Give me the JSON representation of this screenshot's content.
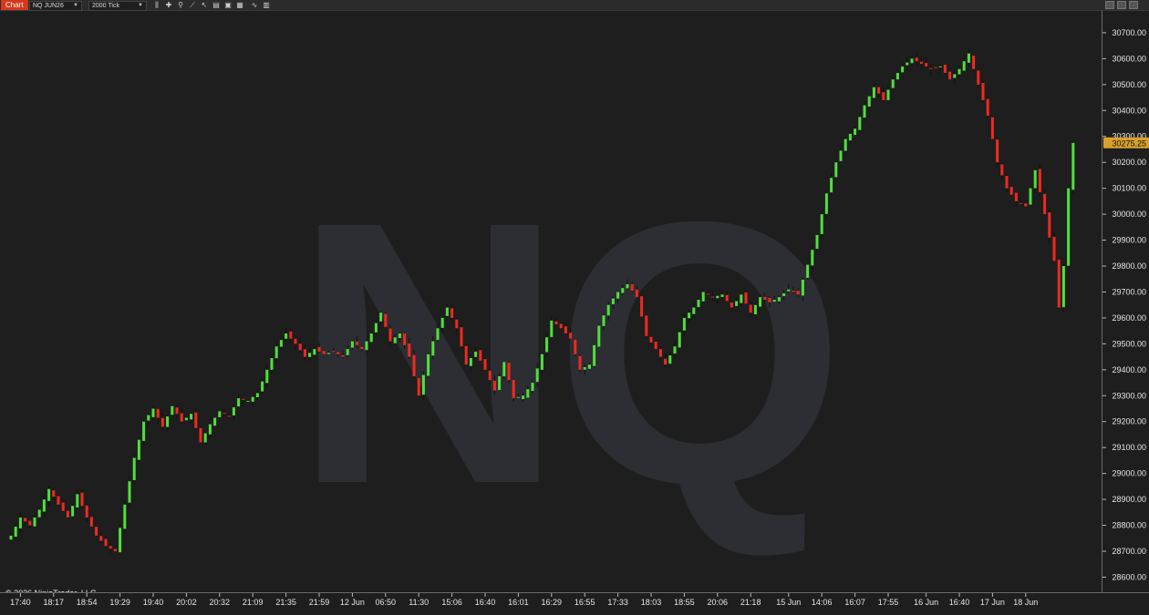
{
  "toolbar": {
    "chart_tab": "Chart",
    "instrument": "NQ JUN26",
    "interval": "2000 Tick",
    "icons": [
      "bar-style-icon",
      "crosshair-icon",
      "zoom-icon",
      "line-tool-icon",
      "pointer-icon",
      "properties-icon",
      "data-box-icon",
      "strategies-icon",
      "indicators-icon",
      "templates-icon"
    ],
    "window_buttons": [
      "minimize-icon",
      "maximize-icon",
      "close-icon"
    ]
  },
  "watermark": "NQ",
  "copyright": "© 2026 NinjaTrader, LLC",
  "colors": {
    "up": "#4fe03b",
    "down": "#f2291f",
    "wick": "#111111",
    "last_price_bg": "#d9a12a",
    "background": "#1e1e1e"
  },
  "chart_data": {
    "type": "candlestick",
    "instrument": "NQ JUN26",
    "interval": "2000 Tick",
    "ylim": [
      28570,
      30770
    ],
    "y_ticks": [
      28600,
      28700,
      28800,
      28900,
      29000,
      29100,
      29200,
      29300,
      29400,
      29500,
      29600,
      29700,
      29800,
      29900,
      30000,
      30100,
      30200,
      30300,
      30400,
      30500,
      30600,
      30700
    ],
    "last_price": 30275.25,
    "last_price_label": "30275.25",
    "x_tick_labels": [
      "17:40",
      "18:17",
      "18:54",
      "19:29",
      "19:40",
      "20:02",
      "20:32",
      "21:09",
      "21:35",
      "21:59",
      "12 Jun",
      "06:50",
      "11:30",
      "15:06",
      "16:40",
      "16:01",
      "16:29",
      "16:55",
      "17:33",
      "18:03",
      "18:55",
      "20:06",
      "21:18",
      "15 Jun",
      "14:06",
      "16:07",
      "17:55",
      "16 Jun",
      "16:40",
      "17 Jun",
      "18 Jun"
    ],
    "x_tick_bar_index": [
      2,
      9,
      16,
      23,
      30,
      37,
      44,
      51,
      58,
      65,
      72,
      79,
      86,
      93,
      100,
      107,
      114,
      121,
      128,
      135,
      142,
      149,
      156,
      164,
      171,
      178,
      185,
      193,
      200,
      207,
      214
    ],
    "close_path": [
      [
        0,
        28760
      ],
      [
        2,
        28830
      ],
      [
        4,
        28800
      ],
      [
        6,
        28860
      ],
      [
        8,
        28940
      ],
      [
        10,
        28880
      ],
      [
        12,
        28830
      ],
      [
        14,
        28920
      ],
      [
        16,
        28830
      ],
      [
        18,
        28760
      ],
      [
        20,
        28720
      ],
      [
        22,
        28700
      ],
      [
        24,
        28880
      ],
      [
        26,
        29060
      ],
      [
        28,
        29200
      ],
      [
        30,
        29250
      ],
      [
        32,
        29180
      ],
      [
        34,
        29260
      ],
      [
        36,
        29200
      ],
      [
        38,
        29230
      ],
      [
        40,
        29120
      ],
      [
        42,
        29190
      ],
      [
        44,
        29240
      ],
      [
        46,
        29220
      ],
      [
        48,
        29290
      ],
      [
        50,
        29280
      ],
      [
        52,
        29310
      ],
      [
        54,
        29400
      ],
      [
        56,
        29490
      ],
      [
        58,
        29540
      ],
      [
        60,
        29500
      ],
      [
        62,
        29450
      ],
      [
        64,
        29480
      ],
      [
        66,
        29460
      ],
      [
        68,
        29470
      ],
      [
        70,
        29450
      ],
      [
        72,
        29510
      ],
      [
        74,
        29480
      ],
      [
        76,
        29540
      ],
      [
        78,
        29620
      ],
      [
        80,
        29510
      ],
      [
        82,
        29540
      ],
      [
        84,
        29450
      ],
      [
        86,
        29300
      ],
      [
        88,
        29460
      ],
      [
        90,
        29560
      ],
      [
        92,
        29640
      ],
      [
        94,
        29560
      ],
      [
        96,
        29420
      ],
      [
        98,
        29470
      ],
      [
        100,
        29400
      ],
      [
        102,
        29320
      ],
      [
        104,
        29430
      ],
      [
        106,
        29290
      ],
      [
        108,
        29300
      ],
      [
        110,
        29350
      ],
      [
        112,
        29460
      ],
      [
        114,
        29590
      ],
      [
        116,
        29560
      ],
      [
        118,
        29520
      ],
      [
        120,
        29400
      ],
      [
        122,
        29420
      ],
      [
        124,
        29570
      ],
      [
        126,
        29650
      ],
      [
        128,
        29700
      ],
      [
        130,
        29730
      ],
      [
        132,
        29680
      ],
      [
        134,
        29530
      ],
      [
        136,
        29480
      ],
      [
        138,
        29420
      ],
      [
        140,
        29490
      ],
      [
        142,
        29600
      ],
      [
        144,
        29640
      ],
      [
        146,
        29700
      ],
      [
        148,
        29680
      ],
      [
        150,
        29690
      ],
      [
        152,
        29640
      ],
      [
        154,
        29690
      ],
      [
        156,
        29620
      ],
      [
        158,
        29680
      ],
      [
        160,
        29660
      ],
      [
        162,
        29680
      ],
      [
        164,
        29710
      ],
      [
        166,
        29690
      ],
      [
        170,
        29920
      ],
      [
        172,
        30080
      ],
      [
        174,
        30200
      ],
      [
        176,
        30290
      ],
      [
        178,
        30330
      ],
      [
        180,
        30420
      ],
      [
        182,
        30490
      ],
      [
        184,
        30440
      ],
      [
        186,
        30520
      ],
      [
        188,
        30570
      ],
      [
        190,
        30600
      ],
      [
        192,
        30580
      ],
      [
        194,
        30560
      ],
      [
        196,
        30570
      ],
      [
        198,
        30520
      ],
      [
        200,
        30560
      ],
      [
        202,
        30620
      ],
      [
        204,
        30500
      ],
      [
        206,
        30380
      ],
      [
        208,
        30200
      ],
      [
        210,
        30100
      ],
      [
        212,
        30050
      ],
      [
        214,
        30030
      ],
      [
        216,
        30170
      ],
      [
        218,
        30000
      ],
      [
        220,
        29820
      ],
      [
        221,
        29640
      ],
      [
        222,
        29800
      ],
      [
        223,
        30100
      ],
      [
        224,
        30275
      ]
    ]
  }
}
